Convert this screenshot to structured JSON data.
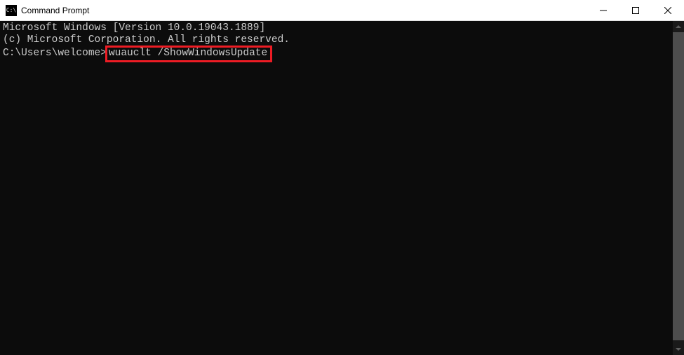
{
  "window": {
    "title": "Command Prompt",
    "icon_text": "C:\\"
  },
  "terminal": {
    "line1": "Microsoft Windows [Version 10.0.19043.1889]",
    "line2": "(c) Microsoft Corporation. All rights reserved.",
    "blank": "",
    "prompt": "C:\\Users\\welcome>",
    "command": "wuauclt /ShowWindowsUpdate"
  },
  "highlight": {
    "color": "#ed1c24"
  }
}
